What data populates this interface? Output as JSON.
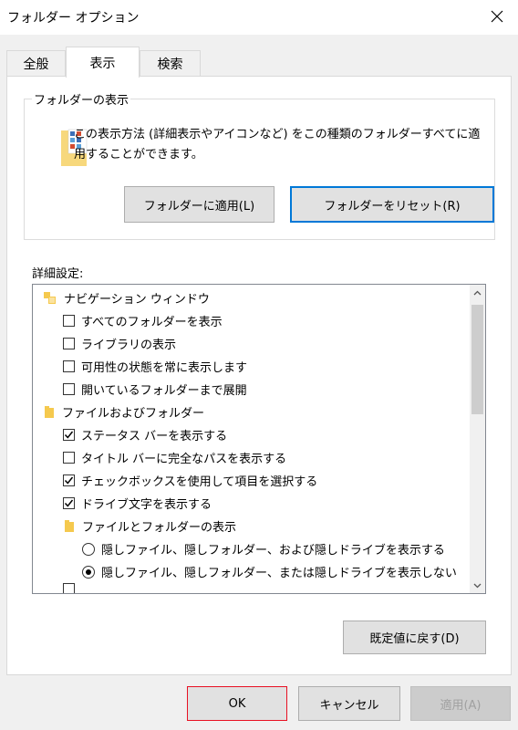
{
  "window": {
    "title": "フォルダー オプション"
  },
  "tabs": [
    {
      "label": "全般"
    },
    {
      "label": "表示"
    },
    {
      "label": "検索"
    }
  ],
  "folder_views": {
    "group_title": "フォルダーの表示",
    "description": "この表示方法 (詳細表示やアイコンなど) をこの種類のフォルダーすべてに適用することができます。",
    "apply_button": "フォルダーに適用(L)",
    "reset_button": "フォルダーをリセット(R)"
  },
  "advanced": {
    "label": "詳細設定:",
    "items": [
      {
        "type": "folder",
        "label": "ナビゲーション ウィンドウ",
        "indent": 0
      },
      {
        "type": "checkbox",
        "label": "すべてのフォルダーを表示",
        "checked": false,
        "indent": 1
      },
      {
        "type": "checkbox",
        "label": "ライブラリの表示",
        "checked": false,
        "indent": 1
      },
      {
        "type": "checkbox",
        "label": "可用性の状態を常に表示します",
        "checked": false,
        "indent": 1
      },
      {
        "type": "checkbox",
        "label": "開いているフォルダーまで展開",
        "checked": false,
        "indent": 1
      },
      {
        "type": "folder",
        "label": "ファイルおよびフォルダー",
        "indent": 0
      },
      {
        "type": "checkbox",
        "label": "ステータス バーを表示する",
        "checked": true,
        "indent": 1
      },
      {
        "type": "checkbox",
        "label": "タイトル バーに完全なパスを表示する",
        "checked": false,
        "indent": 1
      },
      {
        "type": "checkbox",
        "label": "チェックボックスを使用して項目を選択する",
        "checked": true,
        "indent": 1
      },
      {
        "type": "checkbox",
        "label": "ドライブ文字を表示する",
        "checked": true,
        "indent": 1
      },
      {
        "type": "folder",
        "label": "ファイルとフォルダーの表示",
        "indent": 1
      },
      {
        "type": "radio",
        "label": "隠しファイル、隠しフォルダー、および隠しドライブを表示する",
        "checked": false,
        "indent": 2
      },
      {
        "type": "radio",
        "label": "隠しファイル、隠しフォルダー、または隠しドライブを表示しない",
        "checked": true,
        "indent": 2
      }
    ],
    "restore_button": "既定値に戻す(D)"
  },
  "footer": {
    "ok": "OK",
    "cancel": "キャンセル",
    "apply": "適用(A)"
  }
}
